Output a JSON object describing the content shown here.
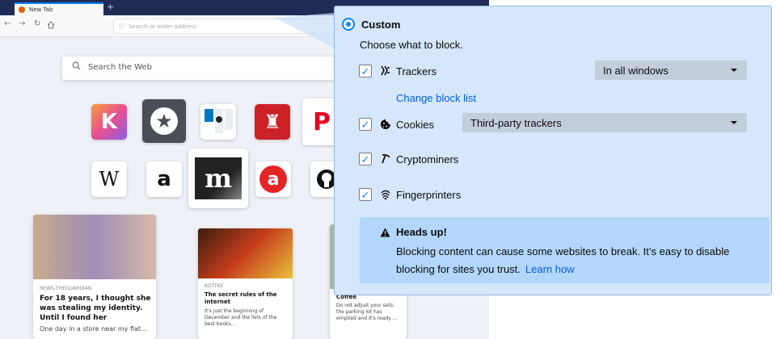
{
  "browser": {
    "tab_title": "New Tab",
    "new_tab_symbol": "+",
    "url_placeholder": "Search or enter address",
    "search_placeholder": "Search the Web",
    "nav": {
      "back": "←",
      "forward": "→",
      "reload": "↻"
    },
    "top_sites_row1": [
      {
        "name": "k-site",
        "glyph": "K",
        "color": "#e86aa8"
      },
      {
        "name": "star-site",
        "glyph": "★",
        "color": "#4a4f57"
      },
      {
        "name": "trello-site",
        "glyph": "",
        "color": "#ffffff"
      },
      {
        "name": "lighthouse-site",
        "glyph": "♜",
        "color": "#cc2127"
      },
      {
        "name": "pinterest-site",
        "glyph": "P",
        "color": "#e60023"
      }
    ],
    "top_sites_row2": [
      {
        "name": "wikipedia-site",
        "glyph": "W",
        "color": "#ffffff"
      },
      {
        "name": "amazon-site",
        "glyph": "a",
        "color": "#ffffff"
      },
      {
        "name": "m-site",
        "glyph": "m",
        "color": "#222222"
      },
      {
        "name": "a-site",
        "glyph": "a",
        "color": "#e42526"
      },
      {
        "name": "github-site",
        "glyph": "",
        "color": "#ffffff"
      }
    ],
    "cards": [
      {
        "source": "NEWS.THEGUARDIAN",
        "title": "For 18 years, I thought she was stealing my identity. Until I found her",
        "excerpt": "One day in a store near my flat..."
      },
      {
        "source": "KOTTKE",
        "title": "The secret rules of the internet",
        "excerpt": "It's just the beginning of December and the lists of the best books..."
      },
      {
        "source": "",
        "title": "Coffee",
        "excerpt": "Do not adjust your sets: the parking lot has emptied and it's ready ..."
      }
    ]
  },
  "panel": {
    "title": "Custom",
    "choose_label": "Choose what to block.",
    "trackers": {
      "label": "Trackers",
      "dropdown": "In all windows",
      "checked": true
    },
    "change_block_list": "Change block list",
    "cookies": {
      "label": "Cookies",
      "dropdown": "Third-party trackers",
      "checked": true
    },
    "cryptominers": {
      "label": "Cryptominers",
      "checked": true
    },
    "fingerprinters": {
      "label": "Fingerprinters",
      "checked": true
    },
    "heads_up": {
      "title": "Heads up!",
      "text": "Blocking content can cause some websites to break. It’s easy to disable blocking for sites you trust.",
      "learn_how": "Learn how"
    },
    "check_mark": "✓",
    "accent": "#0a84ff",
    "link_color": "#0060df"
  }
}
